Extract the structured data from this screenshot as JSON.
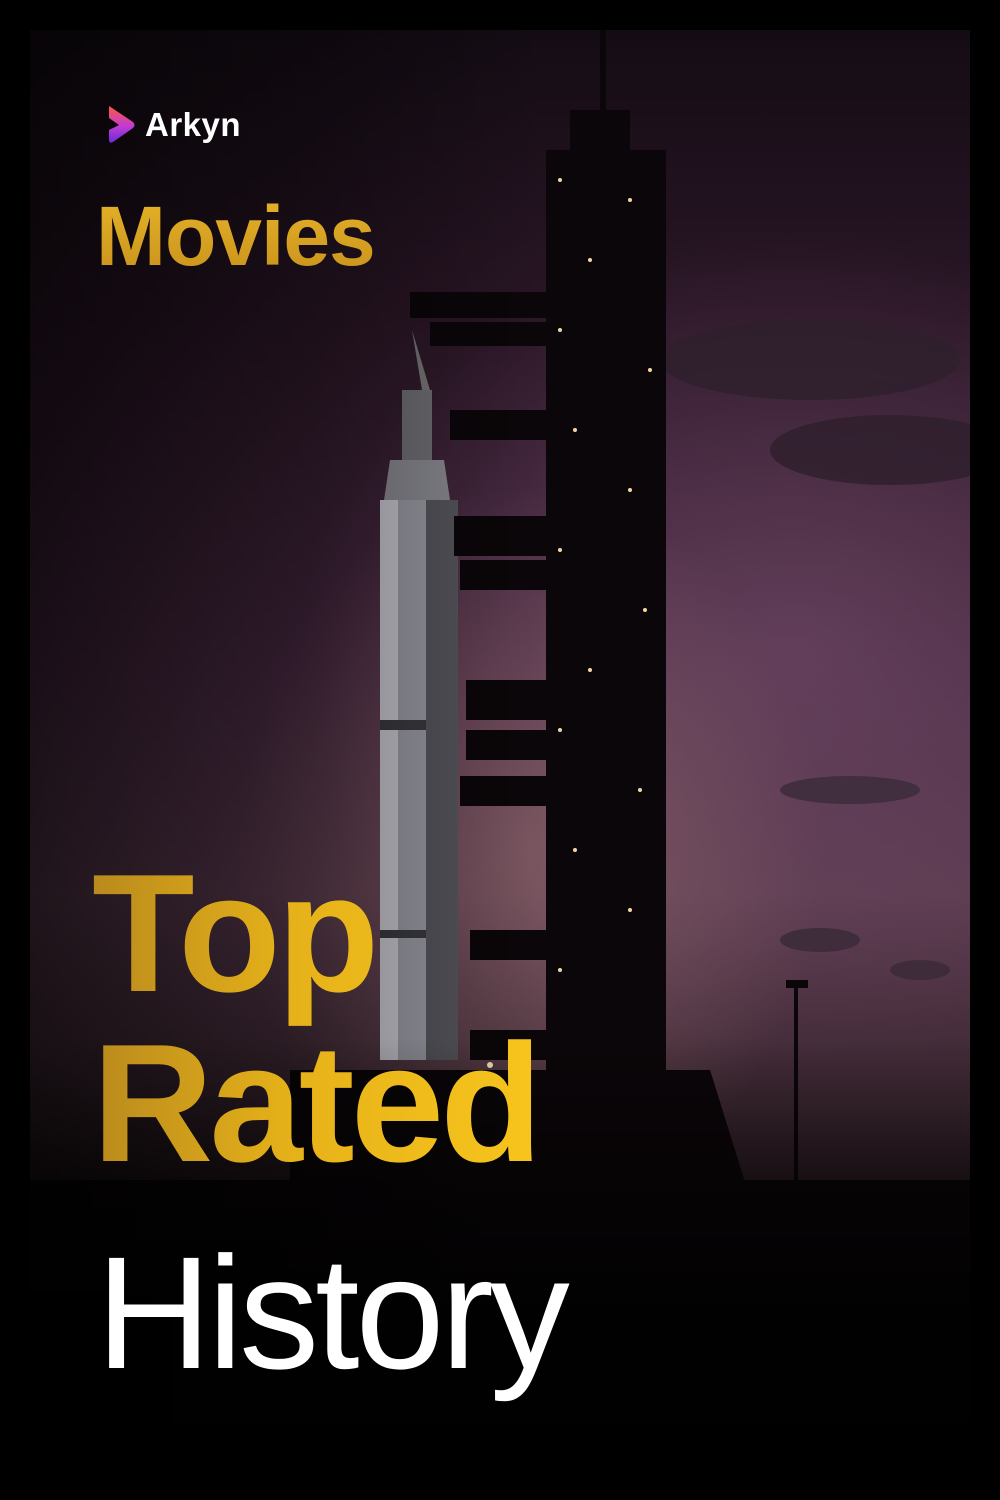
{
  "brand": {
    "name": "Arkyn",
    "logo_icon": "play-heart-logo-icon",
    "logo_colors": [
      "#ff5a3c",
      "#c23bd4",
      "#6a2bd9"
    ]
  },
  "poster": {
    "category": "Movies",
    "headline_line1": "Top",
    "headline_line2": "Rated",
    "subject": "History",
    "accent_color": "#e8b21c",
    "background_photo": "rocket-launch-tower-at-dusk"
  }
}
